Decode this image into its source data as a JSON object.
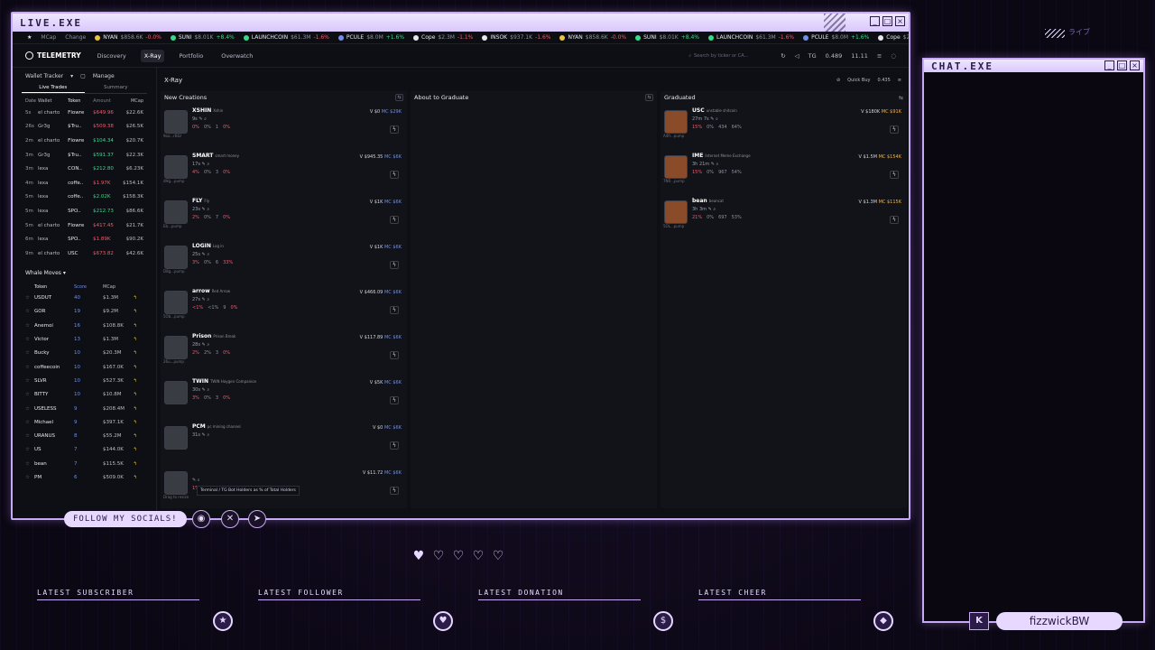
{
  "live_window": {
    "title": "LIVE.EXE"
  },
  "chat_window": {
    "title": "CHAT.EXE"
  },
  "ticker": [
    {
      "name": "NYAN",
      "value": "$858.6K",
      "change": "-0.0%",
      "dir": "down",
      "color": "#e8c440"
    },
    {
      "name": "SUNI",
      "value": "$8.01K",
      "change": "+8.4%",
      "dir": "up",
      "color": "#39d98a"
    },
    {
      "name": "LAUNCHCOIN",
      "value": "$61.3M",
      "change": "-1.6%",
      "dir": "down",
      "color": "#39d98a"
    },
    {
      "name": "PCULE",
      "value": "$8.0M",
      "change": "+1.6%",
      "dir": "up",
      "color": "#6f8fe8"
    },
    {
      "name": "Cope",
      "value": "$2.3M",
      "change": "-1.1%",
      "dir": "down",
      "color": "#e6e8ee"
    },
    {
      "name": "INSOK",
      "value": "$937.1K",
      "change": "-1.6%",
      "dir": "down",
      "color": "#e6e8ee"
    },
    {
      "name": "NYAN",
      "value": "$858.6K",
      "change": "-0.0%",
      "dir": "down",
      "color": "#e8c440"
    },
    {
      "name": "SUNI",
      "value": "$8.01K",
      "change": "+8.4%",
      "dir": "up",
      "color": "#39d98a"
    },
    {
      "name": "LAUNCHCOIN",
      "value": "$61.3M",
      "change": "-1.6%",
      "dir": "down",
      "color": "#39d98a"
    },
    {
      "name": "PCULE",
      "value": "$8.0M",
      "change": "+1.6%",
      "dir": "up",
      "color": "#6f8fe8"
    },
    {
      "name": "Cope",
      "value": "$2.3M",
      "change": "-1.1%",
      "dir": "down",
      "color": "#e6e8ee"
    }
  ],
  "ticker_prefix": {
    "mcap": "MCap",
    "change": "Change"
  },
  "header": {
    "logo": "TELEMETRY",
    "nav": [
      "Discovery",
      "X-Ray",
      "Portfolio",
      "Overwatch"
    ],
    "active_nav": "X-Ray",
    "search_placeholder": "Search by ticker or CA...",
    "right": {
      "tg": "TG",
      "balance": "0.489",
      "count": "11.11"
    }
  },
  "wallet_tracker": {
    "title": "Wallet Tracker",
    "manage": "Manage",
    "tabs": [
      "Live Trades",
      "Summary"
    ],
    "columns": [
      "Date",
      "Wallet",
      "Token",
      "Amount",
      "MCap"
    ],
    "rows": [
      {
        "date": "5s",
        "wallet": "el charto",
        "token": "Flowre",
        "amount": "$649.96",
        "dir": "down",
        "mcap": "$22.6K"
      },
      {
        "date": "26s",
        "wallet": "Gr3g",
        "token": "$Tru..",
        "amount": "$509.38",
        "dir": "down",
        "mcap": "$26.5K"
      },
      {
        "date": "2m",
        "wallet": "el charto",
        "token": "Flowre",
        "amount": "$104.34",
        "dir": "up",
        "mcap": "$20.7K"
      },
      {
        "date": "3m",
        "wallet": "Gr3g",
        "token": "$Tru..",
        "amount": "$591.37",
        "dir": "up",
        "mcap": "$22.3K"
      },
      {
        "date": "3m",
        "wallet": "lexa",
        "token": "CON..",
        "amount": "$212.80",
        "dir": "up",
        "mcap": "$6.23K"
      },
      {
        "date": "4m",
        "wallet": "lexa",
        "token": "coffe..",
        "amount": "$1.97K",
        "dir": "down",
        "mcap": "$154.1K"
      },
      {
        "date": "5m",
        "wallet": "lexa",
        "token": "coffe..",
        "amount": "$2.02K",
        "dir": "up",
        "mcap": "$158.3K"
      },
      {
        "date": "5m",
        "wallet": "lexa",
        "token": "SPO..",
        "amount": "$212.73",
        "dir": "up",
        "mcap": "$86.6K"
      },
      {
        "date": "5m",
        "wallet": "el charto",
        "token": "Flowre",
        "amount": "$417.45",
        "dir": "down",
        "mcap": "$21.7K"
      },
      {
        "date": "6m",
        "wallet": "lexa",
        "token": "SPO..",
        "amount": "$1.89K",
        "dir": "down",
        "mcap": "$90.2K"
      },
      {
        "date": "9m",
        "wallet": "el charto",
        "token": "USC",
        "amount": "$673.82",
        "dir": "down",
        "mcap": "$42.6K"
      }
    ]
  },
  "whale_moves": {
    "title": "Whale Moves",
    "columns": [
      "Token",
      "Score",
      "MCap"
    ],
    "rows": [
      {
        "token": "USDUT",
        "score": "40",
        "mcap": "$1.3M"
      },
      {
        "token": "GOR",
        "score": "19",
        "mcap": "$9.2M"
      },
      {
        "token": "Anemoi",
        "score": "16",
        "mcap": "$108.8K"
      },
      {
        "token": "Victor",
        "score": "13",
        "mcap": "$1.3M"
      },
      {
        "token": "Bucky",
        "score": "10",
        "mcap": "$20.3M"
      },
      {
        "token": "coffeecoin",
        "score": "10",
        "mcap": "$167.0K"
      },
      {
        "token": "SLVR",
        "score": "10",
        "mcap": "$527.3K"
      },
      {
        "token": "BITTY",
        "score": "10",
        "mcap": "$10.8M"
      },
      {
        "token": "USELESS",
        "score": "9",
        "mcap": "$208.4M"
      },
      {
        "token": "Michael",
        "score": "9",
        "mcap": "$397.1K"
      },
      {
        "token": "URANUS",
        "score": "8",
        "mcap": "$55.2M"
      },
      {
        "token": "US",
        "score": "7",
        "mcap": "$144.0K"
      },
      {
        "token": "bean",
        "score": "7",
        "mcap": "$115.5K"
      },
      {
        "token": "PM",
        "score": "6",
        "mcap": "$509.0K"
      }
    ]
  },
  "xray": {
    "title": "X-Ray",
    "quick_buy": "Quick Buy",
    "quick_buy_value": "0.435",
    "columns": [
      "New Creations",
      "About to Graduate",
      "Graduated"
    ],
    "new_creations": [
      {
        "name": "XSHIN",
        "desc": "Xshin",
        "age": "9s",
        "sub": "9oo...rBLV",
        "value": "$0",
        "mcap": "$29K",
        "hot": true,
        "stats": [
          "0%",
          "0%",
          "1",
          "0%"
        ]
      },
      {
        "name": "SMART",
        "desc": "smart money",
        "age": "17s",
        "sub": "dHg...pump",
        "value": "$945.35",
        "mcap": "$6K",
        "hot": false,
        "stats": [
          "4%",
          "0%",
          "3",
          "0%"
        ]
      },
      {
        "name": "FLY",
        "desc": "Fly",
        "age": "23s",
        "sub": "Eb...pump",
        "value": "$1K",
        "mcap": "$6K",
        "hot": false,
        "stats": [
          "2%",
          "0%",
          "7",
          "0%"
        ]
      },
      {
        "name": "LOGIN",
        "desc": "Log in",
        "age": "25s",
        "sub": "D8g...pump",
        "value": "$1K",
        "mcap": "$6K",
        "hot": false,
        "stats": [
          "3%",
          "0%",
          "6",
          "33%"
        ]
      },
      {
        "name": "arrow",
        "desc": "Red Arrow",
        "age": "27s",
        "sub": "5Ob...pump",
        "value": "$466.09",
        "mcap": "$6K",
        "hot": false,
        "stats": [
          "<1%",
          "<1%",
          "9",
          "0%"
        ]
      },
      {
        "name": "Prison",
        "desc": "Prison Break",
        "age": "28s",
        "sub": "26u...pump",
        "value": "$117.89",
        "mcap": "$6K",
        "hot": false,
        "stats": [
          "2%",
          "2%",
          "3",
          "0%"
        ]
      },
      {
        "name": "TWIN",
        "desc": "TWIN Haygen Companion",
        "age": "30s",
        "sub": "",
        "value": "$5K",
        "mcap": "$6K",
        "hot": false,
        "stats": [
          "3%",
          "0%",
          "3",
          "0%"
        ]
      },
      {
        "name": "PCM",
        "desc": "pc mining channel",
        "age": "31s",
        "sub": "",
        "value": "$0",
        "mcap": "$6K",
        "hot": false,
        "stats": [
          "",
          "",
          "",
          ""
        ]
      },
      {
        "name": "",
        "desc": "",
        "age": "",
        "sub": "Drag to resize",
        "value": "$11.72",
        "mcap": "$6K",
        "hot": false,
        "stats": [
          "1%",
          "",
          "",
          "0%"
        ]
      }
    ],
    "graduated": [
      {
        "name": "USC",
        "desc": "unstable shitcoin",
        "age": "27m 7s",
        "sub": "A4fr...pump",
        "value": "$180K",
        "mcap": "$91K",
        "stats": [
          "15%",
          "0%",
          "434",
          "64%"
        ]
      },
      {
        "name": "IME",
        "desc": "Internet Meme Exchange",
        "age": "3h 21m",
        "sub": "7NR...pump",
        "value": "$1.5M",
        "mcap": "$154K",
        "stats": [
          "15%",
          "0%",
          "967",
          "54%"
        ]
      },
      {
        "name": "bean",
        "desc": "beancat",
        "age": "3h 3m",
        "sub": "5OL...pump",
        "value": "$1.3M",
        "mcap": "$115K",
        "stats": [
          "21%",
          "0%",
          "697",
          "53%"
        ]
      }
    ],
    "tooltip": "Terminal / TG Bot Holders as % of Total Holders"
  },
  "overlay": {
    "socials": "FOLLOW MY SOCIALS!",
    "alerts": [
      "LATEST SUBSCRIBER",
      "LATEST FOLLOWER",
      "LATEST DONATION",
      "LATEST CHEER"
    ],
    "username": "fizzwickBW",
    "jp_text": "ライブ"
  },
  "colors": {
    "accent": "#c7a9f5",
    "up": "#39d98a",
    "down": "#f05a6c",
    "mcap": "#6f8fe8"
  }
}
